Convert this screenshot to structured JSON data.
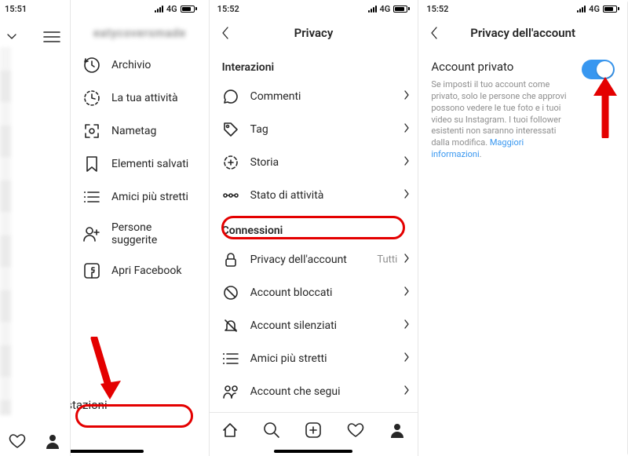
{
  "status": {
    "t1": "15:51",
    "t2": "15:52",
    "t3": "15:52",
    "net": "4G"
  },
  "panel1": {
    "username": "eatycoversmade",
    "items": [
      {
        "key": "archive",
        "label": "Archivio"
      },
      {
        "key": "activity",
        "label": "La tua attività"
      },
      {
        "key": "nametag",
        "label": "Nametag"
      },
      {
        "key": "saved",
        "label": "Elementi salvati"
      },
      {
        "key": "close",
        "label": "Amici più stretti"
      },
      {
        "key": "suggested",
        "label": "Persone suggerite"
      },
      {
        "key": "facebook",
        "label": "Apri Facebook"
      }
    ],
    "settings_label": "Impostazioni"
  },
  "panel2": {
    "title": "Privacy",
    "section1": "Interazioni",
    "items1": [
      {
        "key": "comments",
        "label": "Commenti"
      },
      {
        "key": "tag",
        "label": "Tag"
      },
      {
        "key": "story",
        "label": "Storia"
      },
      {
        "key": "activitystatus",
        "label": "Stato di attività"
      }
    ],
    "section2": "Connessioni",
    "items2": [
      {
        "key": "accountprivacy",
        "label": "Privacy dell'account",
        "meta": "Tutti"
      },
      {
        "key": "blocked",
        "label": "Account bloccati"
      },
      {
        "key": "muted",
        "label": "Account silenziati"
      },
      {
        "key": "closefriends2",
        "label": "Amici più stretti"
      },
      {
        "key": "following",
        "label": "Account che segui"
      }
    ]
  },
  "panel3": {
    "title": "Privacy dell'account",
    "heading": "Account privato",
    "desc": "Se imposti il tuo account come privato, solo le persone che approvi possono vedere le tue foto e i tuoi video su Instagram. I tuoi follower esistenti non saranno interessati dalla modifica. ",
    "link": "Maggiori informazioni",
    "toggle_on": true
  }
}
